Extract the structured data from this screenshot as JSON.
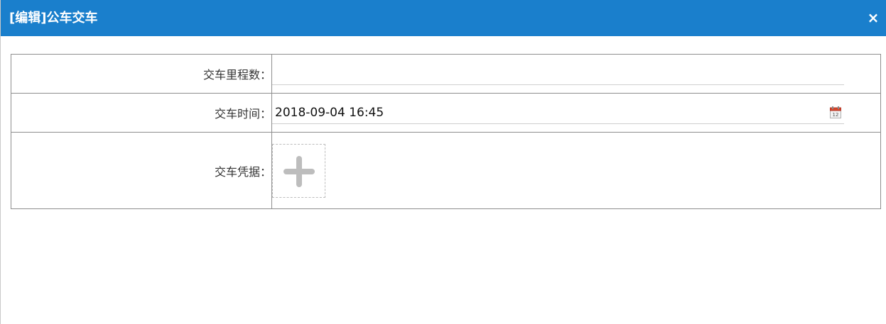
{
  "dialog": {
    "title": "[编辑]公车交车",
    "close_label": "×"
  },
  "form": {
    "mileage": {
      "label": "交车里程数：",
      "value": "",
      "placeholder": ""
    },
    "time": {
      "label": "交车时间：",
      "value": "2018-09-04 16:45",
      "icon": "calendar-icon"
    },
    "voucher": {
      "label": "交车凭据：",
      "icon": "plus-icon"
    }
  },
  "colors": {
    "titlebar": "#1a7fcc",
    "border": "#8e8e8e"
  }
}
